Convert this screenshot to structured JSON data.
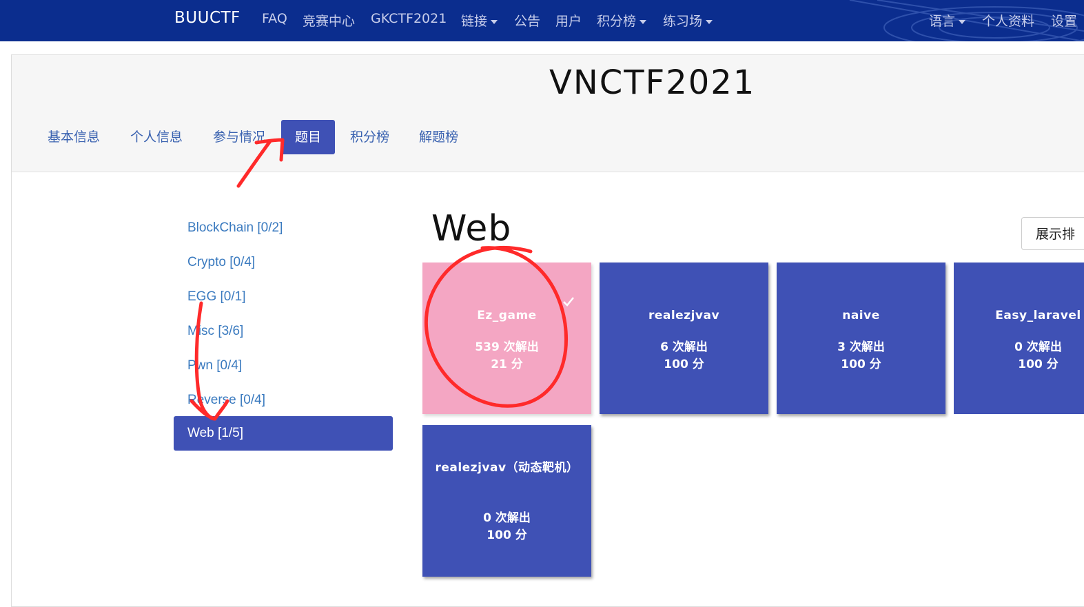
{
  "navbar": {
    "brand": "BUUCTF",
    "items": [
      {
        "label": "FAQ",
        "dropdown": false
      },
      {
        "label": "竞赛中心",
        "dropdown": false
      },
      {
        "label": "GKCTF2021",
        "dropdown": false
      },
      {
        "label": "链接",
        "dropdown": true
      },
      {
        "label": "公告",
        "dropdown": false
      },
      {
        "label": "用户",
        "dropdown": false
      },
      {
        "label": "积分榜",
        "dropdown": true
      },
      {
        "label": "练习场",
        "dropdown": true
      }
    ],
    "right_items": [
      {
        "label": "语言",
        "dropdown": true
      },
      {
        "label": "个人资料",
        "dropdown": false
      },
      {
        "label": "设置",
        "dropdown": false
      }
    ]
  },
  "contest": {
    "title": "VNCTF2021",
    "tabs": [
      {
        "label": "基本信息",
        "active": false
      },
      {
        "label": "个人信息",
        "active": false
      },
      {
        "label": "参与情况",
        "active": false
      },
      {
        "label": "题目",
        "active": true
      },
      {
        "label": "积分榜",
        "active": false
      },
      {
        "label": "解题榜",
        "active": false
      }
    ]
  },
  "categories": [
    {
      "label": "BlockChain [0/2]",
      "active": false
    },
    {
      "label": "Crypto [0/4]",
      "active": false
    },
    {
      "label": "EGG [0/1]",
      "active": false
    },
    {
      "label": "Misc [3/6]",
      "active": false
    },
    {
      "label": "Pwn [0/4]",
      "active": false
    },
    {
      "label": "Reverse [0/4]",
      "active": false
    },
    {
      "label": "Web [1/5]",
      "active": true
    }
  ],
  "section": {
    "title": "Web",
    "rank_button": "展示排"
  },
  "challenges": [
    {
      "name": "Ez_game",
      "solves": "539 次解出",
      "points": "21 分",
      "solved": true
    },
    {
      "name": "realezjvav",
      "solves": "6 次解出",
      "points": "100 分",
      "solved": false
    },
    {
      "name": "naive",
      "solves": "3 次解出",
      "points": "100 分",
      "solved": false
    },
    {
      "name": "Easy_laravel",
      "solves": "0 次解出",
      "points": "100 分",
      "solved": false
    },
    {
      "name": "realezjvav（动态靶机）",
      "solves": "0 次解出",
      "points": "100 分",
      "solved": false
    }
  ],
  "colors": {
    "navbar": "#0b2d8e",
    "accent": "#3f51b5",
    "solved_card": "#f4a6c3",
    "link": "#3a7abf",
    "annotation": "#ff2a2a"
  }
}
